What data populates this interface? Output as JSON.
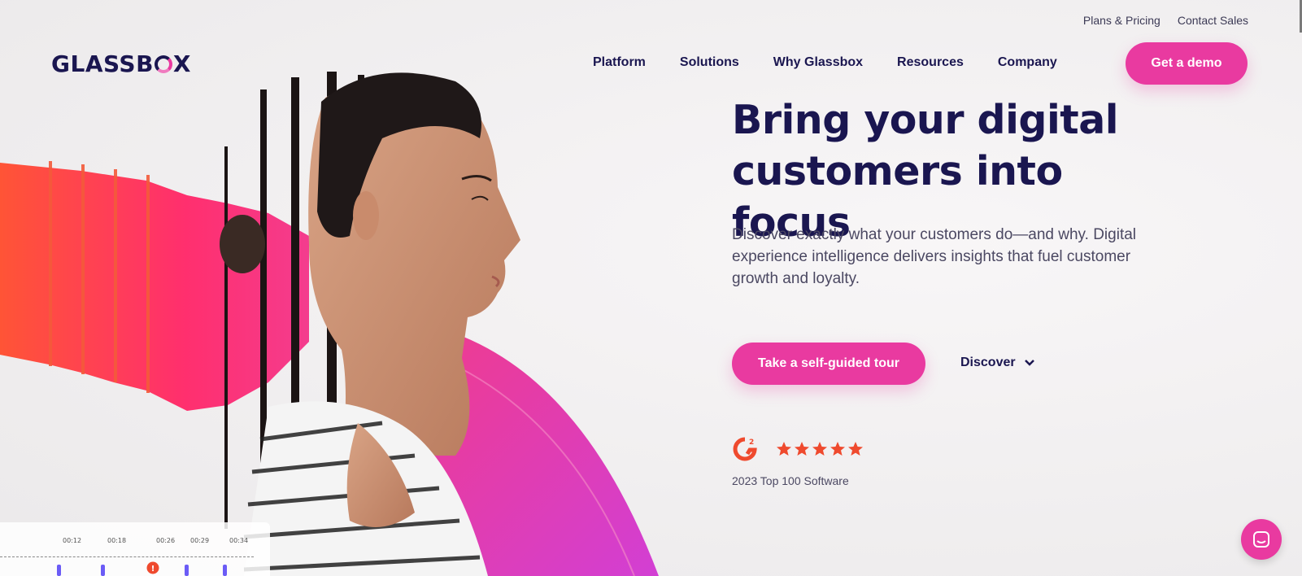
{
  "brand": {
    "logo_pre": "GLASSB",
    "logo_post": "X"
  },
  "utility_nav": {
    "plans": "Plans & Pricing",
    "contact": "Contact Sales"
  },
  "main_nav": {
    "items": [
      "Platform",
      "Solutions",
      "Why Glassbox",
      "Resources",
      "Company"
    ],
    "cta": "Get a demo"
  },
  "hero": {
    "headline_line1": "Bring your digital",
    "headline_line2": "customers into focus",
    "subhead": "Discover exactly what your customers do—and why. Digital experience intelligence delivers insights that fuel customer growth and loyalty.",
    "tour_button": "Take a self-guided tour",
    "discover_label": "Discover"
  },
  "rating": {
    "stars": 5,
    "caption": "2023 Top 100 Software"
  },
  "timeline": {
    "ticks": [
      "00:12",
      "00:18",
      "00:26",
      "00:29",
      "00:34"
    ],
    "alert": "!"
  },
  "colors": {
    "brand_navy": "#1a1650",
    "accent_pink": "#e93aa0",
    "star_orange": "#ef4a2e"
  }
}
